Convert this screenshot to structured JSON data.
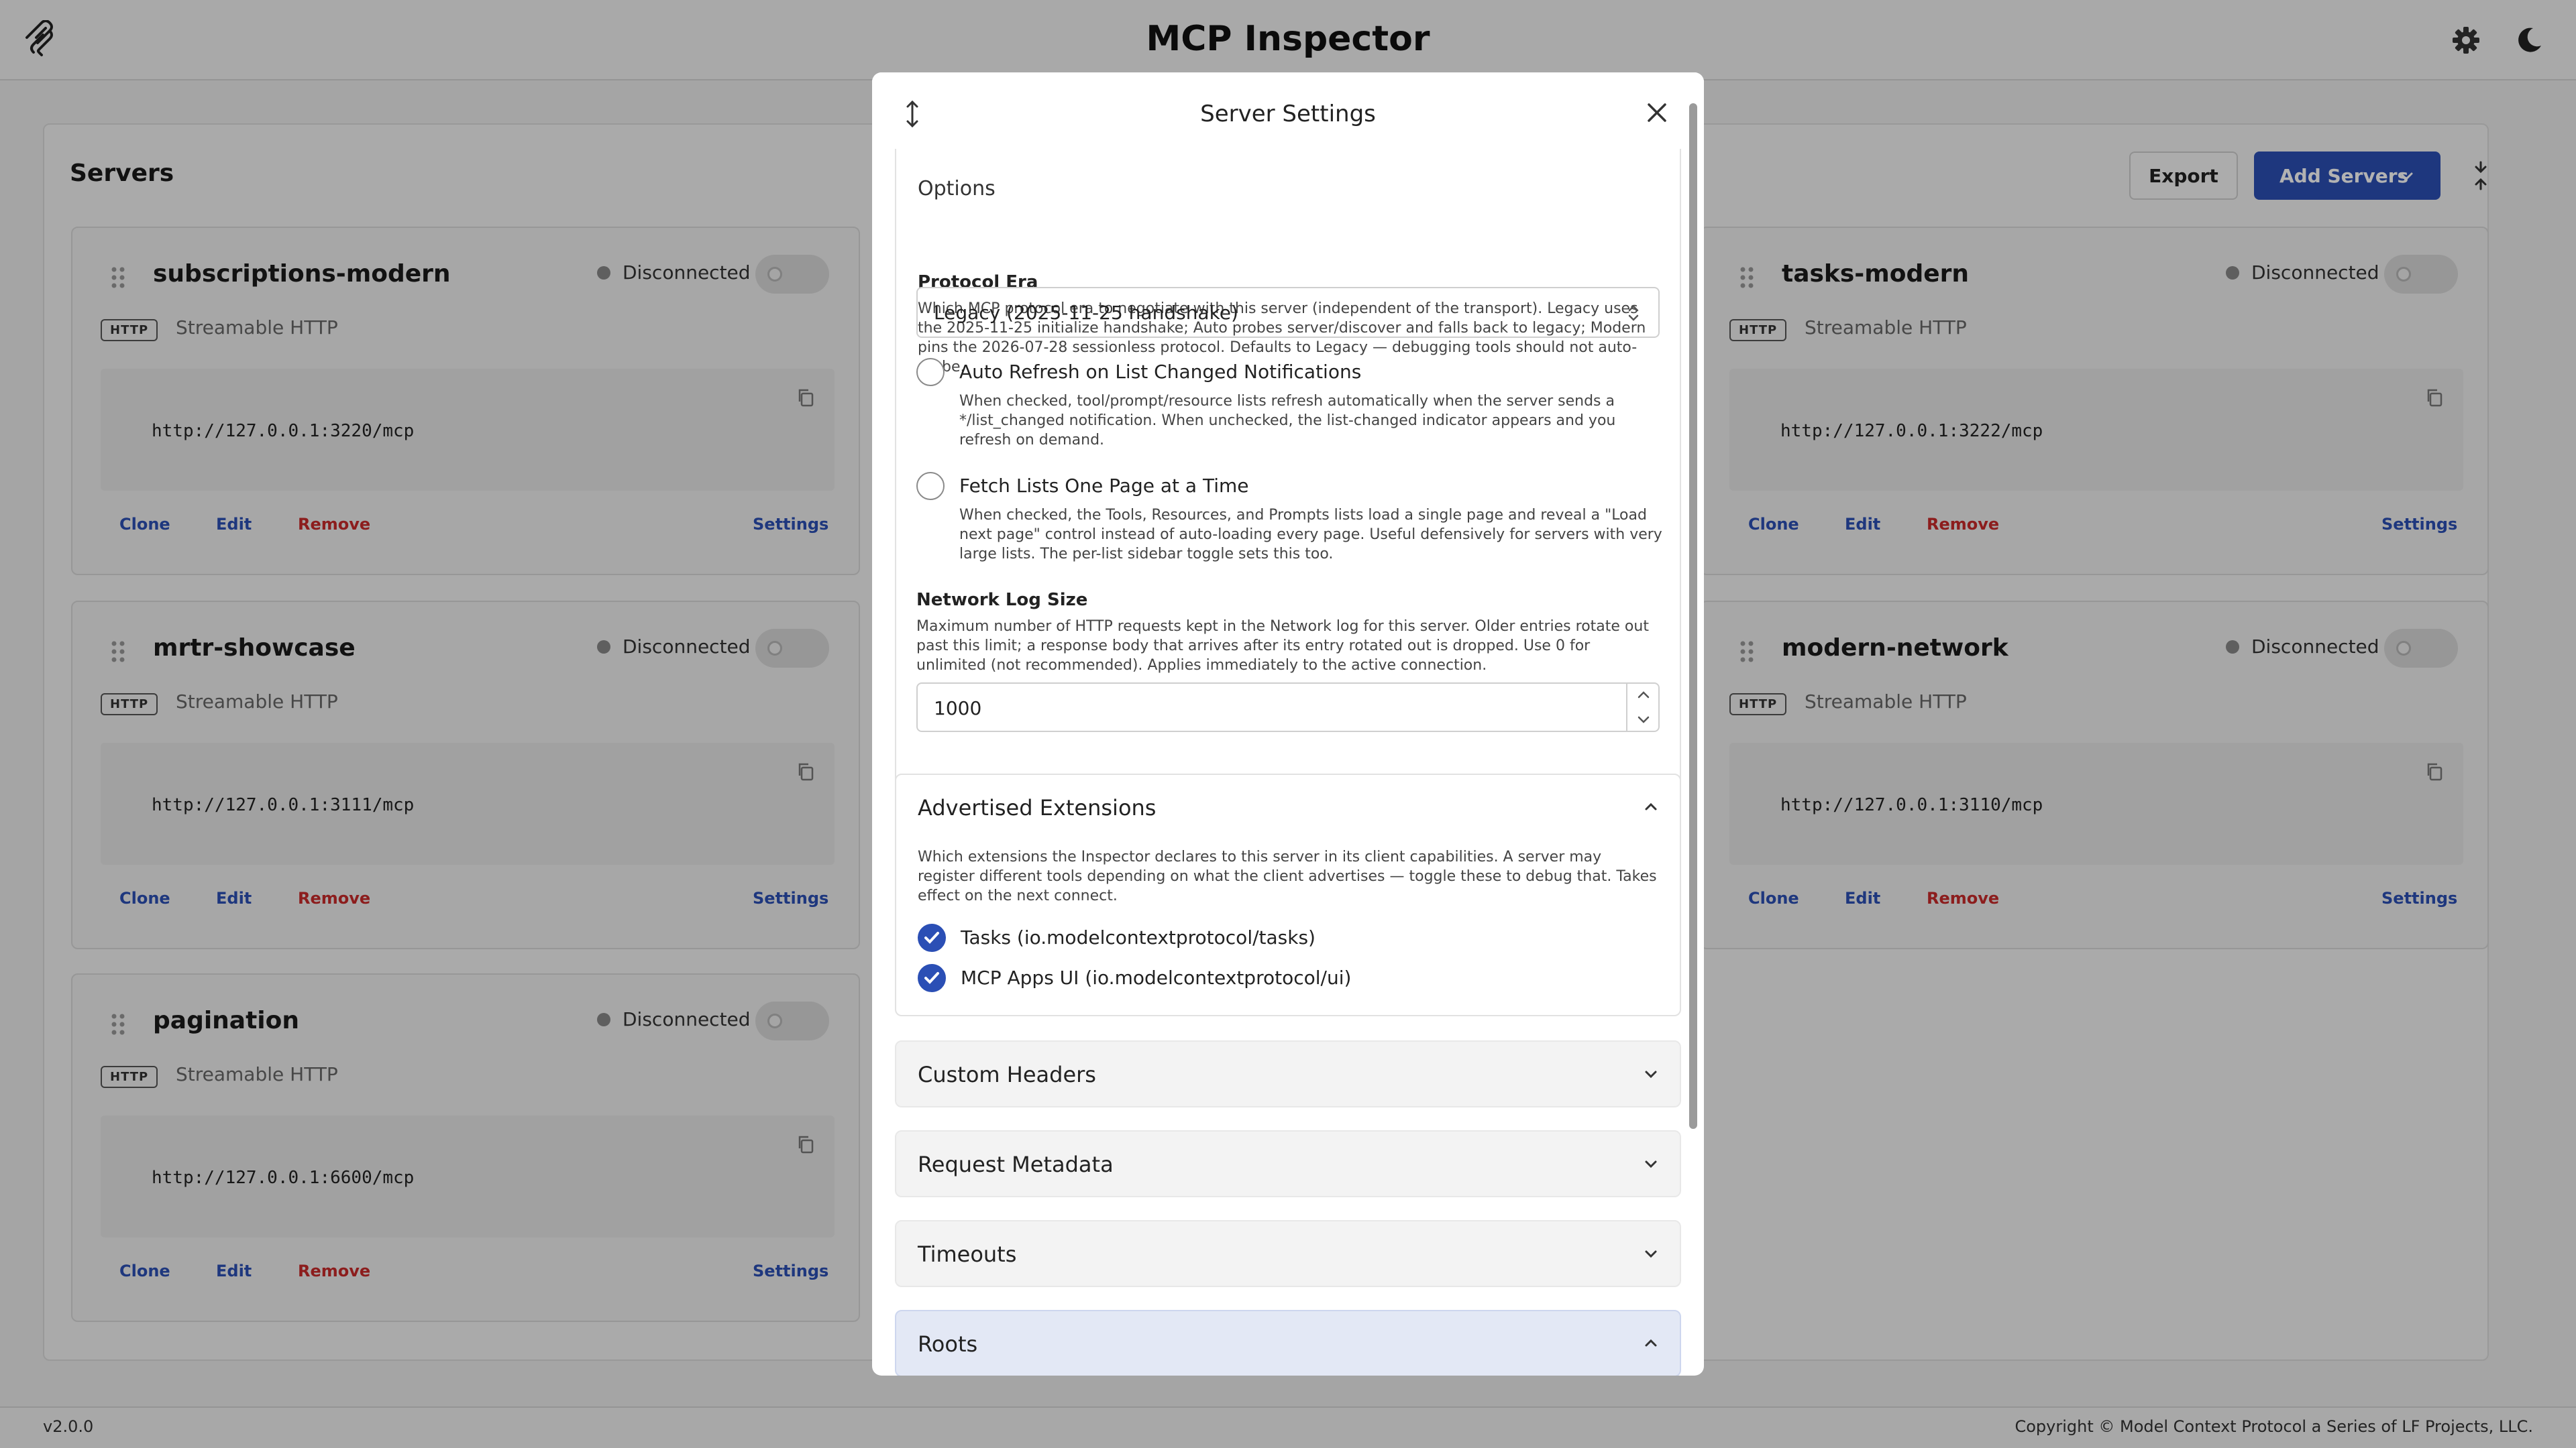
{
  "header": {
    "title": "MCP Inspector"
  },
  "servers": {
    "title": "Servers",
    "export_label": "Export",
    "add_label": "Add Servers",
    "cards": [
      {
        "name": "subscriptions-modern",
        "status": "Disconnected",
        "badge": "HTTP",
        "transport": "Streamable HTTP",
        "url": "http://127.0.0.1:3220/mcp",
        "clone": "Clone",
        "edit": "Edit",
        "remove": "Remove",
        "settings": "Settings"
      },
      {
        "name": "tasks-modern",
        "status": "Disconnected",
        "badge": "HTTP",
        "transport": "Streamable HTTP",
        "url": "http://127.0.0.1:3222/mcp",
        "clone": "Clone",
        "edit": "Edit",
        "remove": "Remove",
        "settings": "Settings"
      },
      {
        "name": "mrtr-showcase",
        "status": "Disconnected",
        "badge": "HTTP",
        "transport": "Streamable HTTP",
        "url": "http://127.0.0.1:3111/mcp",
        "clone": "Clone",
        "edit": "Edit",
        "remove": "Remove",
        "settings": "Settings"
      },
      {
        "name": "modern-network",
        "status": "Disconnected",
        "badge": "HTTP",
        "transport": "Streamable HTTP",
        "url": "http://127.0.0.1:3110/mcp",
        "clone": "Clone",
        "edit": "Edit",
        "remove": "Remove",
        "settings": "Settings"
      },
      {
        "name": "pagination",
        "status": "Disconnected",
        "badge": "HTTP",
        "transport": "Streamable HTTP",
        "url": "http://127.0.0.1:6600/mcp",
        "clone": "Clone",
        "edit": "Edit",
        "remove": "Remove",
        "settings": "Settings"
      }
    ]
  },
  "modal": {
    "title": "Server Settings",
    "options": {
      "label": "Options",
      "protocol_era": {
        "label": "Protocol Era",
        "help": "Which MCP protocol era to negotiate with this server (independent of the transport). Legacy uses the 2025-11-25 initialize handshake; Auto probes server/discover and falls back to legacy; Modern pins the 2026-07-28 sessionless protocol. Defaults to Legacy — debugging tools should not auto-probe.",
        "value": "Legacy (2025-11-25 handshake)"
      },
      "auto_refresh": {
        "label": "Auto Refresh on List Changed Notifications",
        "help": "When checked, tool/prompt/resource lists refresh automatically when the server sends a */list_changed notification. When unchecked, the list-changed indicator appears and you refresh on demand.",
        "checked": false
      },
      "fetch_pages": {
        "label": "Fetch Lists One Page at a Time",
        "help": "When checked, the Tools, Resources, and Prompts lists load a single page and reveal a \"Load next page\" control instead of auto-loading every page. Useful defensively for servers with very large lists. The per-list sidebar toggle sets this too.",
        "checked": false
      },
      "network_log": {
        "label": "Network Log Size",
        "help": "Maximum number of HTTP requests kept in the Network log for this server. Older entries rotate out past this limit; a response body that arrives after its entry rotated out is dropped. Use 0 for unlimited (not recommended). Applies immediately to the active connection.",
        "value": "1000"
      }
    },
    "extensions": {
      "title": "Advertised Extensions",
      "help": "Which extensions the Inspector declares to this server in its client capabilities. A server may register different tools depending on what the client advertises — toggle these to debug that. Takes effect on the next connect.",
      "items": [
        {
          "label": "Tasks (io.modelcontextprotocol/tasks)",
          "checked": true
        },
        {
          "label": "MCP Apps UI (io.modelcontextprotocol/ui)",
          "checked": true
        }
      ]
    },
    "sections": [
      {
        "title": "Custom Headers",
        "expanded": false
      },
      {
        "title": "Request Metadata",
        "expanded": false
      },
      {
        "title": "Timeouts",
        "expanded": false
      },
      {
        "title": "Roots",
        "expanded": true
      }
    ]
  },
  "footer": {
    "version": "v2.0.0",
    "copyright": "Copyright © Model Context Protocol a Series of LF Projects, LLC."
  },
  "colors": {
    "accent": "#2b4fb5",
    "danger": "#c92a2a",
    "status_dot": "#888888"
  }
}
